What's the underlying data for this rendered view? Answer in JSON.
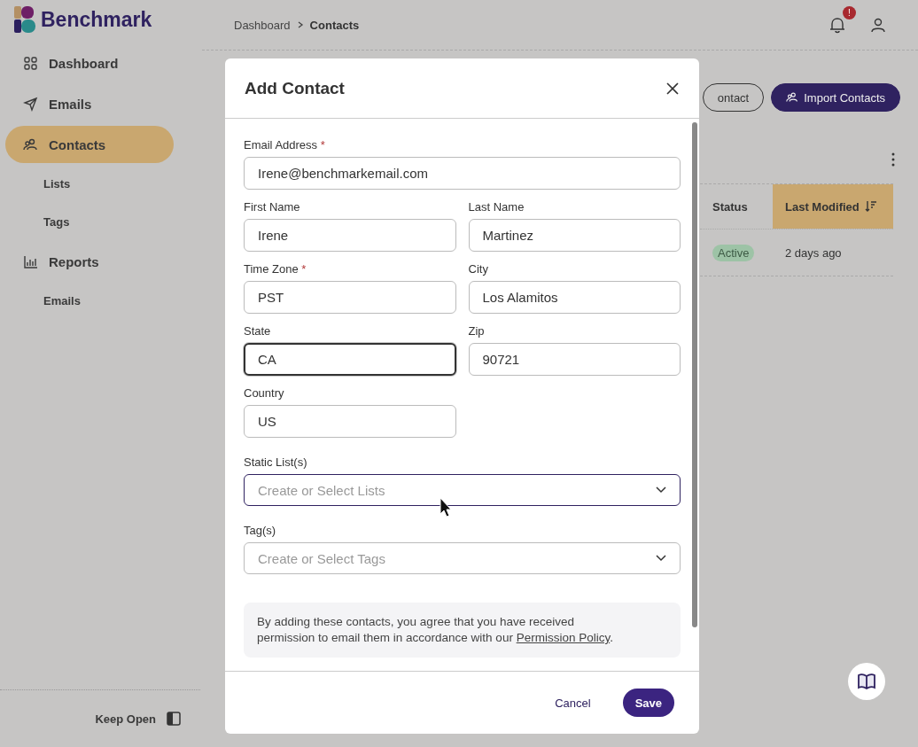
{
  "brand": {
    "name": "Benchmark"
  },
  "sidebar": {
    "items": [
      {
        "label": "Dashboard",
        "selected": false
      },
      {
        "label": "Emails",
        "selected": false
      },
      {
        "label": "Contacts",
        "selected": true,
        "children": [
          {
            "label": "Lists",
            "selected": false
          },
          {
            "label": "Tags",
            "selected": false
          }
        ]
      },
      {
        "label": "Reports",
        "selected": false,
        "children": [
          {
            "label": "Emails",
            "selected": false
          }
        ]
      }
    ],
    "footer": {
      "label": "Keep Open"
    }
  },
  "breadcrumb": [
    "Dashboard",
    "Contacts"
  ],
  "notifications": {
    "badge": "!"
  },
  "actions": [
    {
      "label": "ontact",
      "kind": "outline"
    },
    {
      "label": "Import Contacts",
      "kind": "primary"
    }
  ],
  "table": {
    "columns": [
      {
        "label": "Status",
        "sorted": false
      },
      {
        "label": "Last Modified",
        "sorted": true
      }
    ],
    "rows": [
      {
        "cells": [
          {
            "text": "Active",
            "kind": "badge"
          },
          {
            "text": "2 days ago",
            "kind": "text"
          }
        ]
      }
    ]
  },
  "modal": {
    "title": "Add Contact",
    "rows": [
      [
        {
          "label": "Email Address",
          "required_mark": "*",
          "kind": "text",
          "value": "Irene@benchmarkemail.com",
          "focused": false
        }
      ],
      [
        {
          "label": "First Name",
          "kind": "text",
          "value": "Irene",
          "focused": false
        },
        {
          "label": "Last Name",
          "kind": "text",
          "value": "Martinez",
          "focused": false
        }
      ],
      [
        {
          "label": "Time Zone",
          "required_mark": "*",
          "kind": "text",
          "value": "PST",
          "focused": false
        },
        {
          "label": "City",
          "kind": "text",
          "value": "Los Alamitos",
          "focused": false
        }
      ],
      [
        {
          "label": "State",
          "kind": "text",
          "value": "CA",
          "focused": true
        },
        {
          "label": "Zip",
          "kind": "text",
          "value": "90721",
          "focused": false
        }
      ],
      [
        {
          "label": "Country",
          "kind": "text",
          "value": "US",
          "focused": false
        }
      ],
      [
        {
          "label": "Static List(s)",
          "kind": "select",
          "placeholder": "Create or Select Lists",
          "focused": true
        }
      ],
      [
        {
          "label": "Tag(s)",
          "kind": "select",
          "placeholder": "Create or Select Tags",
          "focused": false
        }
      ]
    ],
    "notice": {
      "text": "By adding these contacts, you agree that you have received permission to email them in accordance with our ",
      "link": "Permission Policy",
      "end": "."
    },
    "buttons": [
      {
        "label": "Cancel",
        "kind": "text"
      },
      {
        "label": "Save",
        "kind": "primary"
      }
    ]
  }
}
